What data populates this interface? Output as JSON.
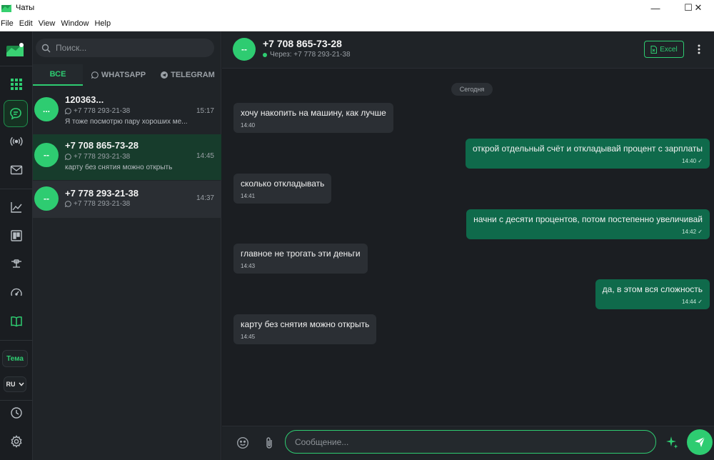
{
  "window": {
    "title": "Чаты",
    "controls": [
      "—",
      "☐",
      "✕"
    ]
  },
  "menu": [
    "File",
    "Edit",
    "View",
    "Window",
    "Help"
  ],
  "rail": {
    "items": [
      "grid-icon",
      "chat-icon",
      "broadcast-icon",
      "mail-icon",
      "chart-icon",
      "board-icon",
      "pipeline-icon",
      "gauge-icon",
      "book-icon"
    ],
    "theme_label": "Тема",
    "lang_label": "RU",
    "bottom": [
      "clock-icon",
      "gear-icon"
    ]
  },
  "chat_list": {
    "search_placeholder": "Поиск...",
    "tabs": [
      {
        "label": "ВСЕ"
      },
      {
        "label": "WHATSAPP"
      },
      {
        "label": "TELEGRAM"
      }
    ],
    "chats": [
      {
        "avatar": "...",
        "name": "120363...",
        "via": "+7 778 293-21-38",
        "preview": "Я тоже посмотрю пару хороших ме...",
        "time": "15:17"
      },
      {
        "avatar": "--",
        "name": "+7 708 865-73-28",
        "via": "+7 778 293-21-38",
        "preview": "карту без снятия можно открыть",
        "time": "14:45"
      },
      {
        "avatar": "--",
        "name": "+7 778 293-21-38",
        "via": "+7 778 293-21-38",
        "preview": "",
        "time": "14:37"
      }
    ]
  },
  "conversation": {
    "contact_name": "+7 708 865-73-28",
    "via_label": "Через: +7 778 293-21-38",
    "avatar": "--",
    "excel_label": "Excel",
    "date_divider": "Сегодня",
    "messages": [
      {
        "dir": "in",
        "text": "хочу накопить на машину, как лучше",
        "time": "14:40"
      },
      {
        "dir": "out",
        "text": "открой отдельный счёт и откладывай процент с зарплаты",
        "time": "14:40 ✓"
      },
      {
        "dir": "in",
        "text": "сколько откладывать",
        "time": "14:41"
      },
      {
        "dir": "out",
        "text": "начни с десяти процентов, потом постепенно увеличивай",
        "time": "14:42 ✓"
      },
      {
        "dir": "in",
        "text": "главное не трогать эти деньги",
        "time": "14:43"
      },
      {
        "dir": "out",
        "text": "да, в этом вся сложность",
        "time": "14:44 ✓"
      },
      {
        "dir": "in",
        "text": "карту без снятия можно открыть",
        "time": "14:45"
      }
    ],
    "composer_placeholder": "Сообщение..."
  },
  "colors": {
    "accent": "#2ecc71",
    "outgoing_bubble": "#0f6a4b",
    "incoming_bubble": "#2b2f34",
    "background": "#1b1e22"
  }
}
